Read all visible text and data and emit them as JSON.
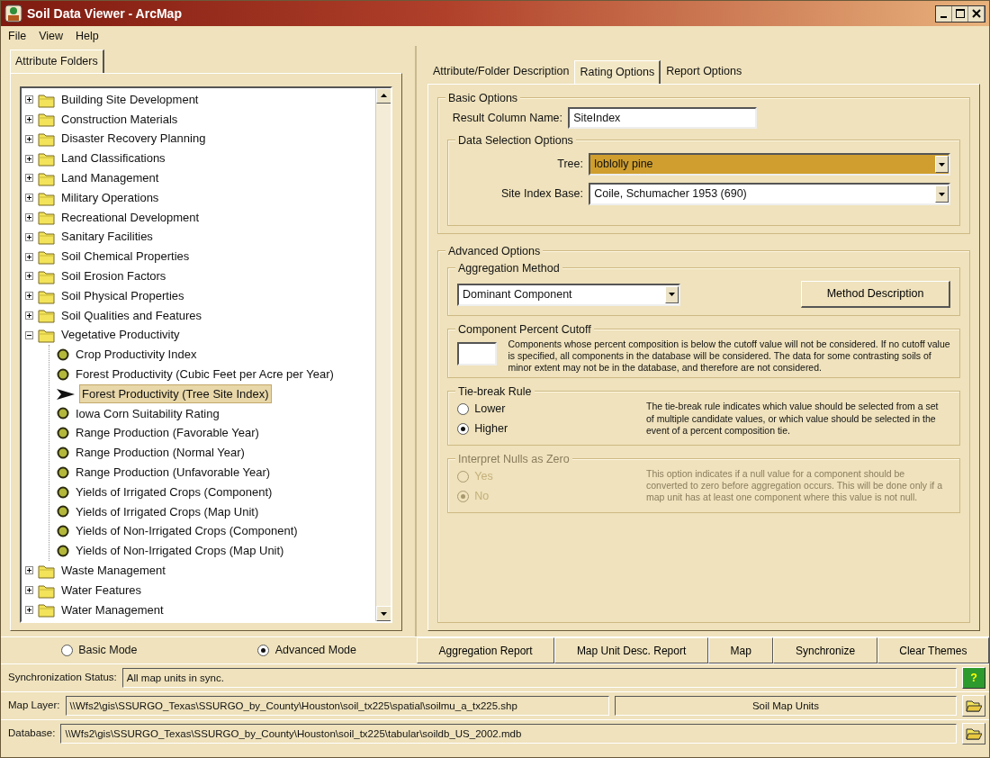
{
  "window": {
    "title": "Soil Data Viewer - ArcMap"
  },
  "menu": [
    "File",
    "View",
    "Help"
  ],
  "left_tab": {
    "label": "Attribute Folders",
    "selected": true
  },
  "tree": [
    {
      "label": "Building Site Development",
      "expanded": false
    },
    {
      "label": "Construction Materials",
      "expanded": false
    },
    {
      "label": "Disaster Recovery Planning",
      "expanded": false
    },
    {
      "label": "Land Classifications",
      "expanded": false
    },
    {
      "label": "Land Management",
      "expanded": false
    },
    {
      "label": "Military Operations",
      "expanded": false
    },
    {
      "label": "Recreational Development",
      "expanded": false
    },
    {
      "label": "Sanitary Facilities",
      "expanded": false
    },
    {
      "label": "Soil Chemical Properties",
      "expanded": false
    },
    {
      "label": "Soil Erosion Factors",
      "expanded": false
    },
    {
      "label": "Soil Physical Properties",
      "expanded": false
    },
    {
      "label": "Soil Qualities and Features",
      "expanded": false
    },
    {
      "label": "Vegetative Productivity",
      "expanded": true,
      "children": [
        {
          "label": "Crop Productivity Index",
          "selected": false
        },
        {
          "label": "Forest Productivity (Cubic Feet per Acre per Year)",
          "selected": false
        },
        {
          "label": "Forest Productivity (Tree Site Index)",
          "selected": true
        },
        {
          "label": "Iowa Corn Suitability Rating",
          "selected": false
        },
        {
          "label": "Range Production (Favorable Year)",
          "selected": false
        },
        {
          "label": "Range Production (Normal Year)",
          "selected": false
        },
        {
          "label": "Range Production (Unfavorable Year)",
          "selected": false
        },
        {
          "label": "Yields of Irrigated Crops (Component)",
          "selected": false
        },
        {
          "label": "Yields of Irrigated Crops (Map Unit)",
          "selected": false
        },
        {
          "label": "Yields of Non-Irrigated Crops (Component)",
          "selected": false
        },
        {
          "label": "Yields of Non-Irrigated Crops (Map Unit)",
          "selected": false
        }
      ]
    },
    {
      "label": "Waste Management",
      "expanded": false
    },
    {
      "label": "Water Features",
      "expanded": false
    },
    {
      "label": "Water Management",
      "expanded": false
    }
  ],
  "modes": [
    {
      "label": "Basic Mode",
      "selected": false
    },
    {
      "label": "Advanced Mode",
      "selected": true
    }
  ],
  "right_tabs": [
    {
      "label": "Attribute/Folder Description",
      "selected": false
    },
    {
      "label": "Rating Options",
      "selected": true
    },
    {
      "label": "Report Options",
      "selected": false
    }
  ],
  "basic_options": {
    "legend": "Basic Options",
    "result_column": {
      "label": "Result Column Name:",
      "value": "SiteIndex"
    },
    "data_selection": {
      "legend": "Data Selection Options",
      "fields": [
        {
          "label": "Tree:",
          "value": "loblolly pine",
          "highlighted": true
        },
        {
          "label": "Site Index Base:",
          "value": "Coile, Schumacher 1953 (690)",
          "highlighted": false
        }
      ]
    }
  },
  "advanced_options": {
    "legend": "Advanced Options",
    "aggregation": {
      "legend": "Aggregation Method",
      "value": "Dominant Component",
      "button": "Method Description"
    },
    "cutoff": {
      "legend": "Component Percent Cutoff",
      "description": "Components whose percent composition is below the cutoff value will not be considered.  If no cutoff value is specified, all components in the database will be considered.  The data for some contrasting soils of minor extent may not be in the database, and therefore are not considered."
    },
    "groups": [
      {
        "legend": "Tie-break Rule",
        "disabled": false,
        "options": [
          {
            "label": "Lower",
            "selected": false
          },
          {
            "label": "Higher",
            "selected": true
          }
        ],
        "description": "The tie-break rule indicates which value should be selected from a set of multiple candidate values, or which value should be selected in the event of a percent composition tie."
      },
      {
        "legend": "Interpret Nulls as Zero",
        "disabled": true,
        "options": [
          {
            "label": "Yes",
            "selected": false
          },
          {
            "label": "No",
            "selected": true
          }
        ],
        "description": "This option indicates if a null value for a component should be converted to zero before aggregation occurs.  This will be done only if a map unit has at least one component where this value is not null."
      }
    ]
  },
  "action_buttons": [
    "Aggregation Report",
    "Map Unit Desc. Report",
    "Map",
    "Synchronize",
    "Clear Themes"
  ],
  "sync_status": {
    "label": "Synchronization Status:",
    "value": "All map units in sync.",
    "help": "?"
  },
  "map_layer": {
    "label": "Map Layer:",
    "value": "\\\\Wfs2\\gis\\SSURGO_Texas\\SSURGO_by_County\\Houston\\soil_tx225\\spatial\\soilmu_a_tx225.shp",
    "layer_name": "Soil Map Units"
  },
  "database": {
    "label": "Database:",
    "value": "\\\\Wfs2\\gis\\SSURGO_Texas\\SSURGO_by_County\\Houston\\soil_tx225\\tabular\\soildb_US_2002.mdb"
  }
}
